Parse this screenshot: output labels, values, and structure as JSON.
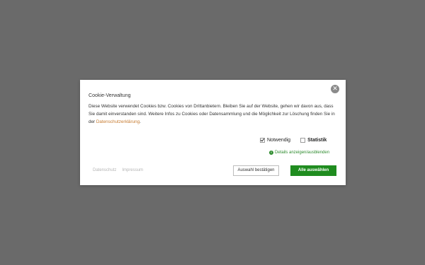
{
  "modal": {
    "title": "Cookie-Verwaltung",
    "description_part1": "Diese Website verwendet Cookies bzw. Cookies von Drittanbietern. Bleiben Sie auf der Website, gehen wir davon aus, dass Sie damit einverstanden sind. Weitere Infos zu Cookies oder Datensammlung und die Möglichkeit zur Löschung finden Sie in der ",
    "privacy_link": "Datenschutzerklärung",
    "description_part2": ".",
    "close_icon": "close-icon",
    "close_glyph": "✕"
  },
  "checkboxes": [
    {
      "label": "Notwendig",
      "checked": true
    },
    {
      "label": "Statistik",
      "checked": false
    }
  ],
  "details": {
    "icon": "info-icon",
    "icon_glyph": "i",
    "label": "Details anzeigen/ausblenden"
  },
  "footer": {
    "links": [
      "Datenschutz",
      "Impressum"
    ]
  },
  "buttons": {
    "accept_selection": "Auswahl bestätigen",
    "accept_all": "Alle auswählen"
  },
  "colors": {
    "overlay": "#6a6a6a",
    "accent_green": "#1f8c1f",
    "link_orange": "#c77b30",
    "muted_link": "#b5b5b5"
  }
}
